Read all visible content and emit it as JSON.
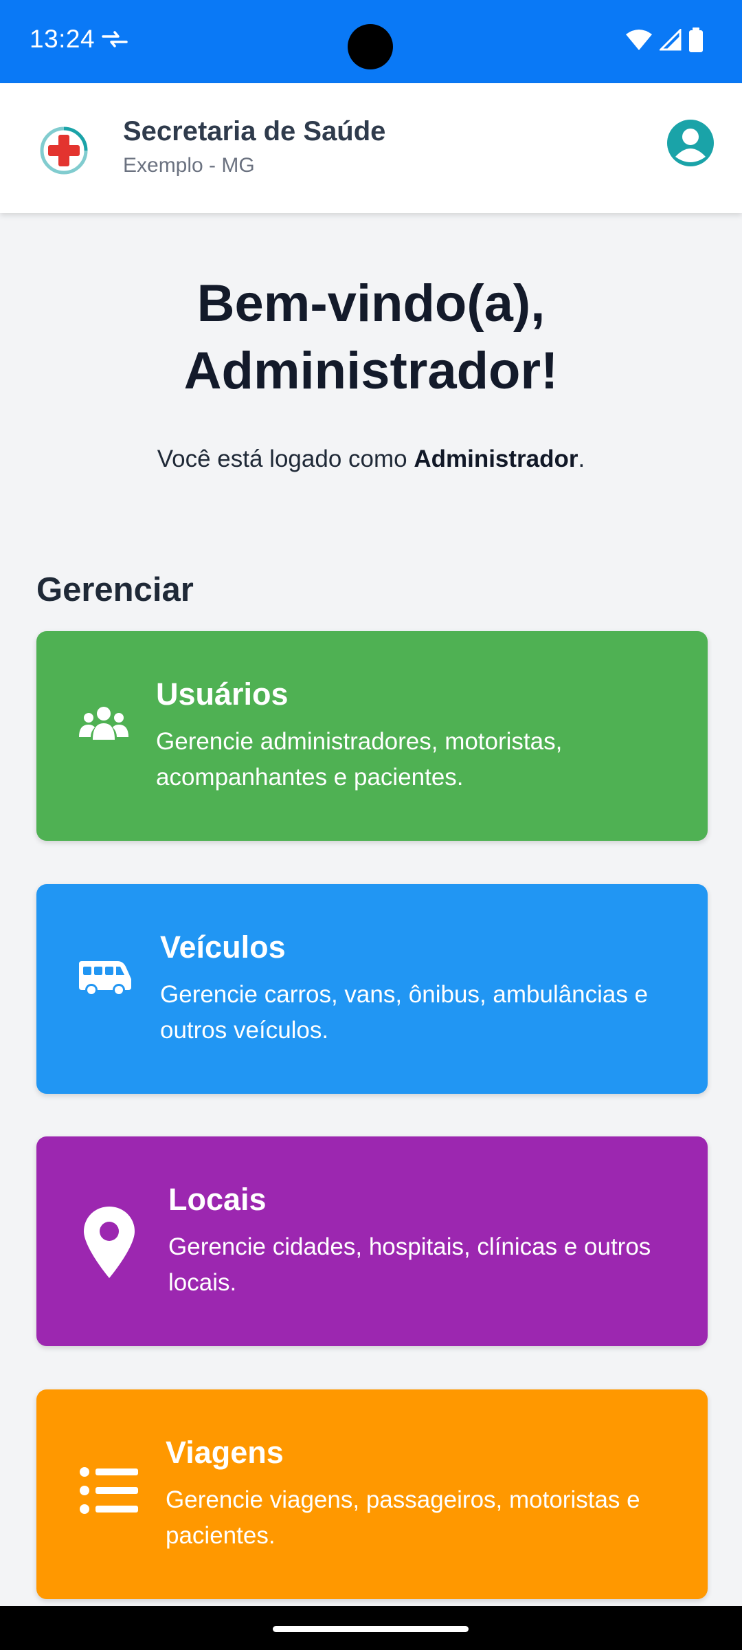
{
  "status_bar": {
    "time": "13:24",
    "background": "#0a79f6"
  },
  "header": {
    "title": "Secretaria de Saúde",
    "subtitle": "Exemplo - MG",
    "logo_icon": "medical-cross-icon",
    "profile_icon": "user-circle-icon",
    "accent": "#1aa3a8"
  },
  "welcome": {
    "line1": "Bem-vindo(a),",
    "line2": "Administrador!",
    "logged_prefix": "Você está logado como ",
    "role": "Administrador",
    "logged_suffix": "."
  },
  "section_title": "Gerenciar",
  "cards": [
    {
      "title": "Usuários",
      "description": "Gerencie administradores, motoristas, acompanhantes e pacientes.",
      "icon": "users-icon",
      "color": "#4fb153"
    },
    {
      "title": "Veículos",
      "description": "Gerencie carros, vans, ônibus, ambulâncias e outros veículos.",
      "icon": "van-icon",
      "color": "#2196f3"
    },
    {
      "title": "Locais",
      "description": "Gerencie cidades, hospitais, clínicas e outros locais.",
      "icon": "map-pin-icon",
      "color": "#9c27b0"
    },
    {
      "title": "Viagens",
      "description": "Gerencie viagens, passageiros, motoristas e pacientes.",
      "icon": "list-icon",
      "color": "#ff9800"
    }
  ]
}
